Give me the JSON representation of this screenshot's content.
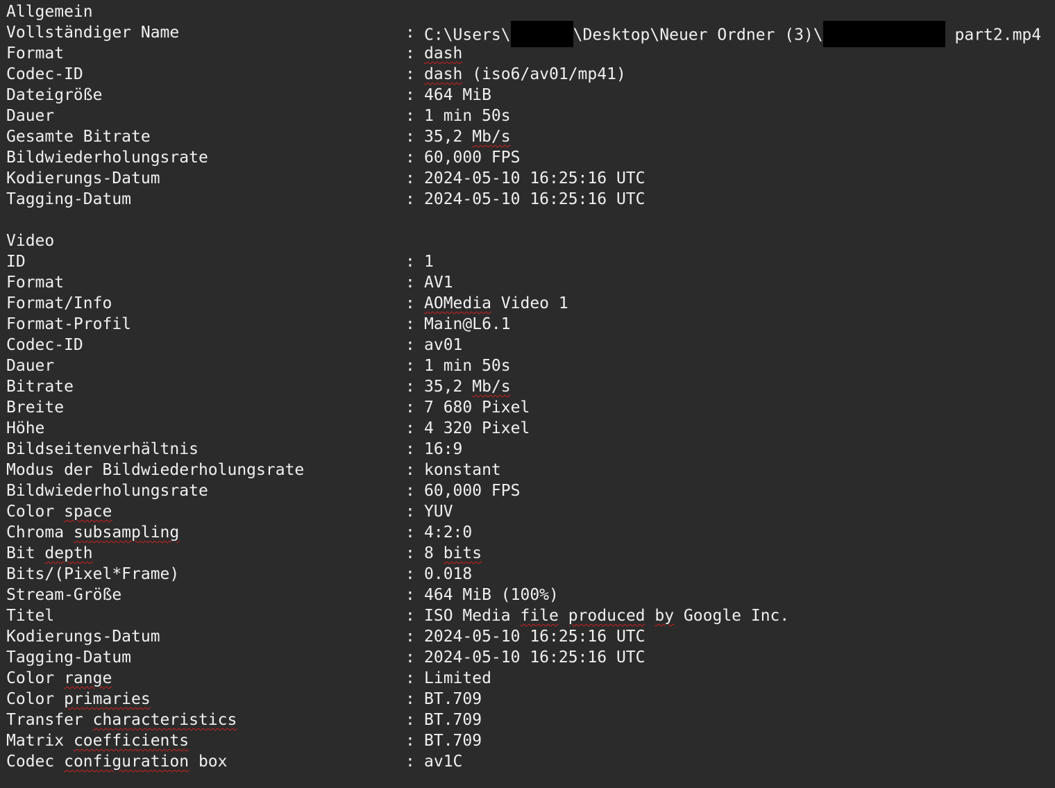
{
  "general": {
    "section_title": "Allgemein",
    "full_name_label": "Vollständiger Name",
    "full_name_prefix": "C:\\Users\\",
    "full_name_mid": "\\Desktop\\Neuer Ordner (3)\\",
    "full_name_suffix": " part2.mp4",
    "format_label": "Format",
    "format_value": "dash",
    "codec_id_label": "Codec-ID",
    "codec_id_value_a": "dash",
    "codec_id_value_b": " (iso6/av01/mp41)",
    "file_size_label": "Dateigröße",
    "file_size_value": "464 MiB",
    "duration_label": "Dauer",
    "duration_value": "1 min 50s",
    "overall_bitrate_label": "Gesamte Bitrate",
    "overall_bitrate_num": "35,2 ",
    "overall_bitrate_unit": "Mb/s",
    "frame_rate_label": "Bildwiederholungsrate",
    "frame_rate_value": "60,000 FPS",
    "encoded_date_label": "Kodierungs-Datum",
    "encoded_date_value": "2024-05-10 16:25:16 UTC",
    "tagged_date_label": "Tagging-Datum",
    "tagged_date_value": "2024-05-10 16:25:16 UTC"
  },
  "video": {
    "section_title": "Video",
    "id_label": "ID",
    "id_value": "1",
    "format_label": "Format",
    "format_value": "AV1",
    "format_info_label": "Format/Info",
    "format_info_a": "AOMedia",
    "format_info_b": " Video 1",
    "format_profile_label": "Format-Profil",
    "format_profile_value": "Main@L6.1",
    "codec_id_label": "Codec-ID",
    "codec_id_value": "av01",
    "duration_label": "Dauer",
    "duration_value": "1 min 50s",
    "bitrate_label": "Bitrate",
    "bitrate_num": "35,2 ",
    "bitrate_unit": "Mb/s",
    "width_label": "Breite",
    "width_value": "7 680 Pixel",
    "height_label": "Höhe",
    "height_value": "4 320 Pixel",
    "aspect_label": "Bildseitenverhältnis",
    "aspect_value": "16:9",
    "frame_rate_mode_label": "Modus der Bildwiederholungsrate",
    "frame_rate_mode_value": "konstant",
    "frame_rate_label": "Bildwiederholungsrate",
    "frame_rate_value": "60,000 FPS",
    "color_space_label_a": "Color ",
    "color_space_label_b": "space",
    "color_space_value": "YUV",
    "chroma_label_a": "Chroma ",
    "chroma_label_b": "subsampling",
    "chroma_value": "4:2:0",
    "bit_depth_label_a": "Bit ",
    "bit_depth_label_b": "depth",
    "bit_depth_value_a": "8 ",
    "bit_depth_value_b": "bits",
    "bpf_label": "Bits/(Pixel*Frame)",
    "bpf_value": "0.018",
    "stream_size_label": "Stream-Größe",
    "stream_size_value": "464 MiB (100%)",
    "title_label": "Titel",
    "title_value_a": "ISO Media ",
    "title_value_b": "file",
    "title_value_c": " ",
    "title_value_d": "produced",
    "title_value_e": " ",
    "title_value_f": "by",
    "title_value_g": " Google Inc.",
    "encoded_date_label": "Kodierungs-Datum",
    "encoded_date_value": "2024-05-10 16:25:16 UTC",
    "tagged_date_label": "Tagging-Datum",
    "tagged_date_value": "2024-05-10 16:25:16 UTC",
    "color_range_label_a": "Color ",
    "color_range_label_b": "range",
    "color_range_value": "Limited",
    "color_primaries_label_a": "Color ",
    "color_primaries_label_b": "primaries",
    "color_primaries_value": "BT.709",
    "transfer_label_a": "Transfer ",
    "transfer_label_b": "characteristics",
    "transfer_value": "BT.709",
    "matrix_label_a": "Matrix ",
    "matrix_label_b": "coefficients",
    "matrix_value": "BT.709",
    "config_box_label_a": "Codec ",
    "config_box_label_b": "configuration",
    "config_box_label_c": " box",
    "config_box_value": "av1C"
  },
  "separator": ":",
  "colors": {
    "background": "#2b2b2b",
    "text": "#f0f0f0",
    "spellcheck_underline": "#d02020",
    "redaction": "#000000"
  }
}
